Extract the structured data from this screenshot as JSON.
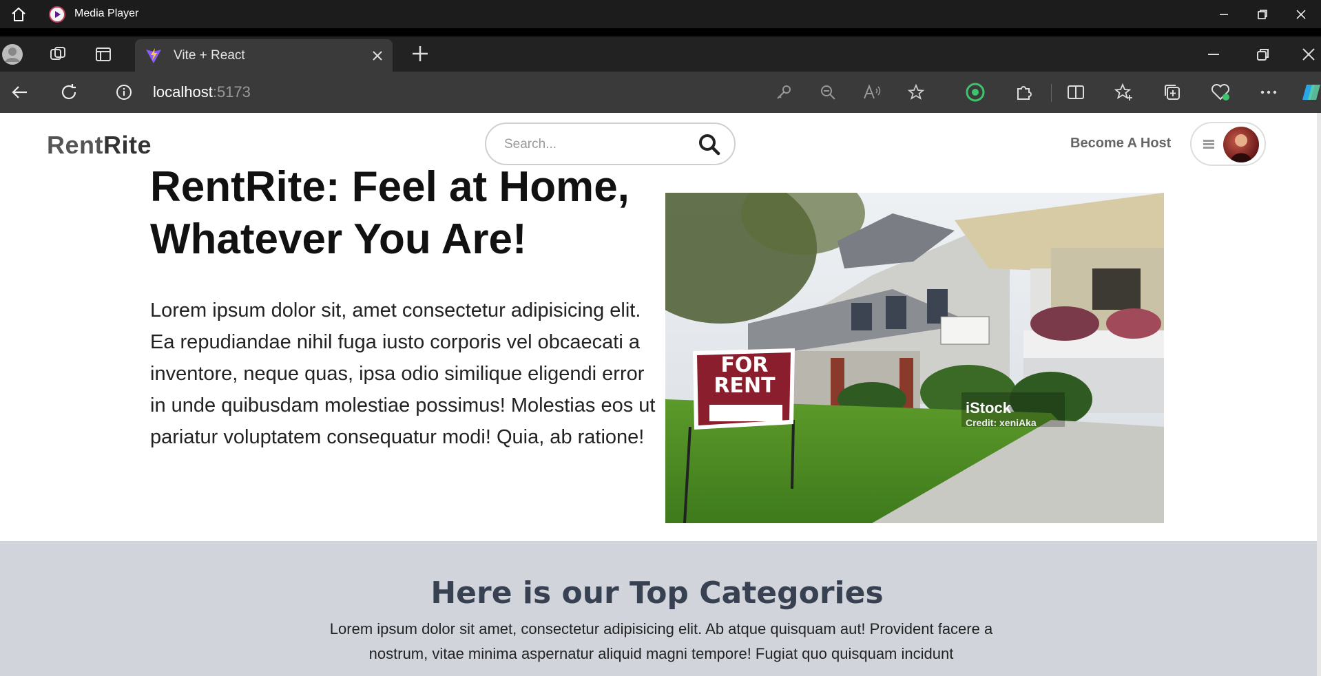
{
  "media_player": {
    "title": "Media Player"
  },
  "browser": {
    "tab": {
      "title": "Vite + React"
    },
    "address": {
      "host": "localhost",
      "port": ":5173"
    }
  },
  "site": {
    "logo_part1": "Rent",
    "logo_part2": "Rite",
    "search_placeholder": "Search...",
    "become_host": "Become A Host",
    "hero": {
      "title": "RentRite: Feel at Home, Whatever You Are!",
      "text": "Lorem ipsum dolor sit, amet consectetur adipisicing elit. Ea repudiandae nihil fuga iusto corporis vel obcaecati a inventore, neque quas, ipsa odio similique eligendi error in unde quibusdam molestiae possimus! Molestias eos ut pariatur voluptatem consequatur modi! Quia, ab ratione!",
      "image": {
        "sign_line1": "FOR",
        "sign_line2": "RENT",
        "credit_brand": "iStock",
        "credit_by": "Credit: xeniAka"
      }
    },
    "categories": {
      "title": "Here is our Top Categories",
      "text": "Lorem ipsum dolor sit amet, consectetur adipisicing elit. Ab atque quisquam aut! Provident facere a nostrum, vitae minima aspernatur aliquid magni tempore! Fugiat quo quisquam incidunt"
    }
  }
}
